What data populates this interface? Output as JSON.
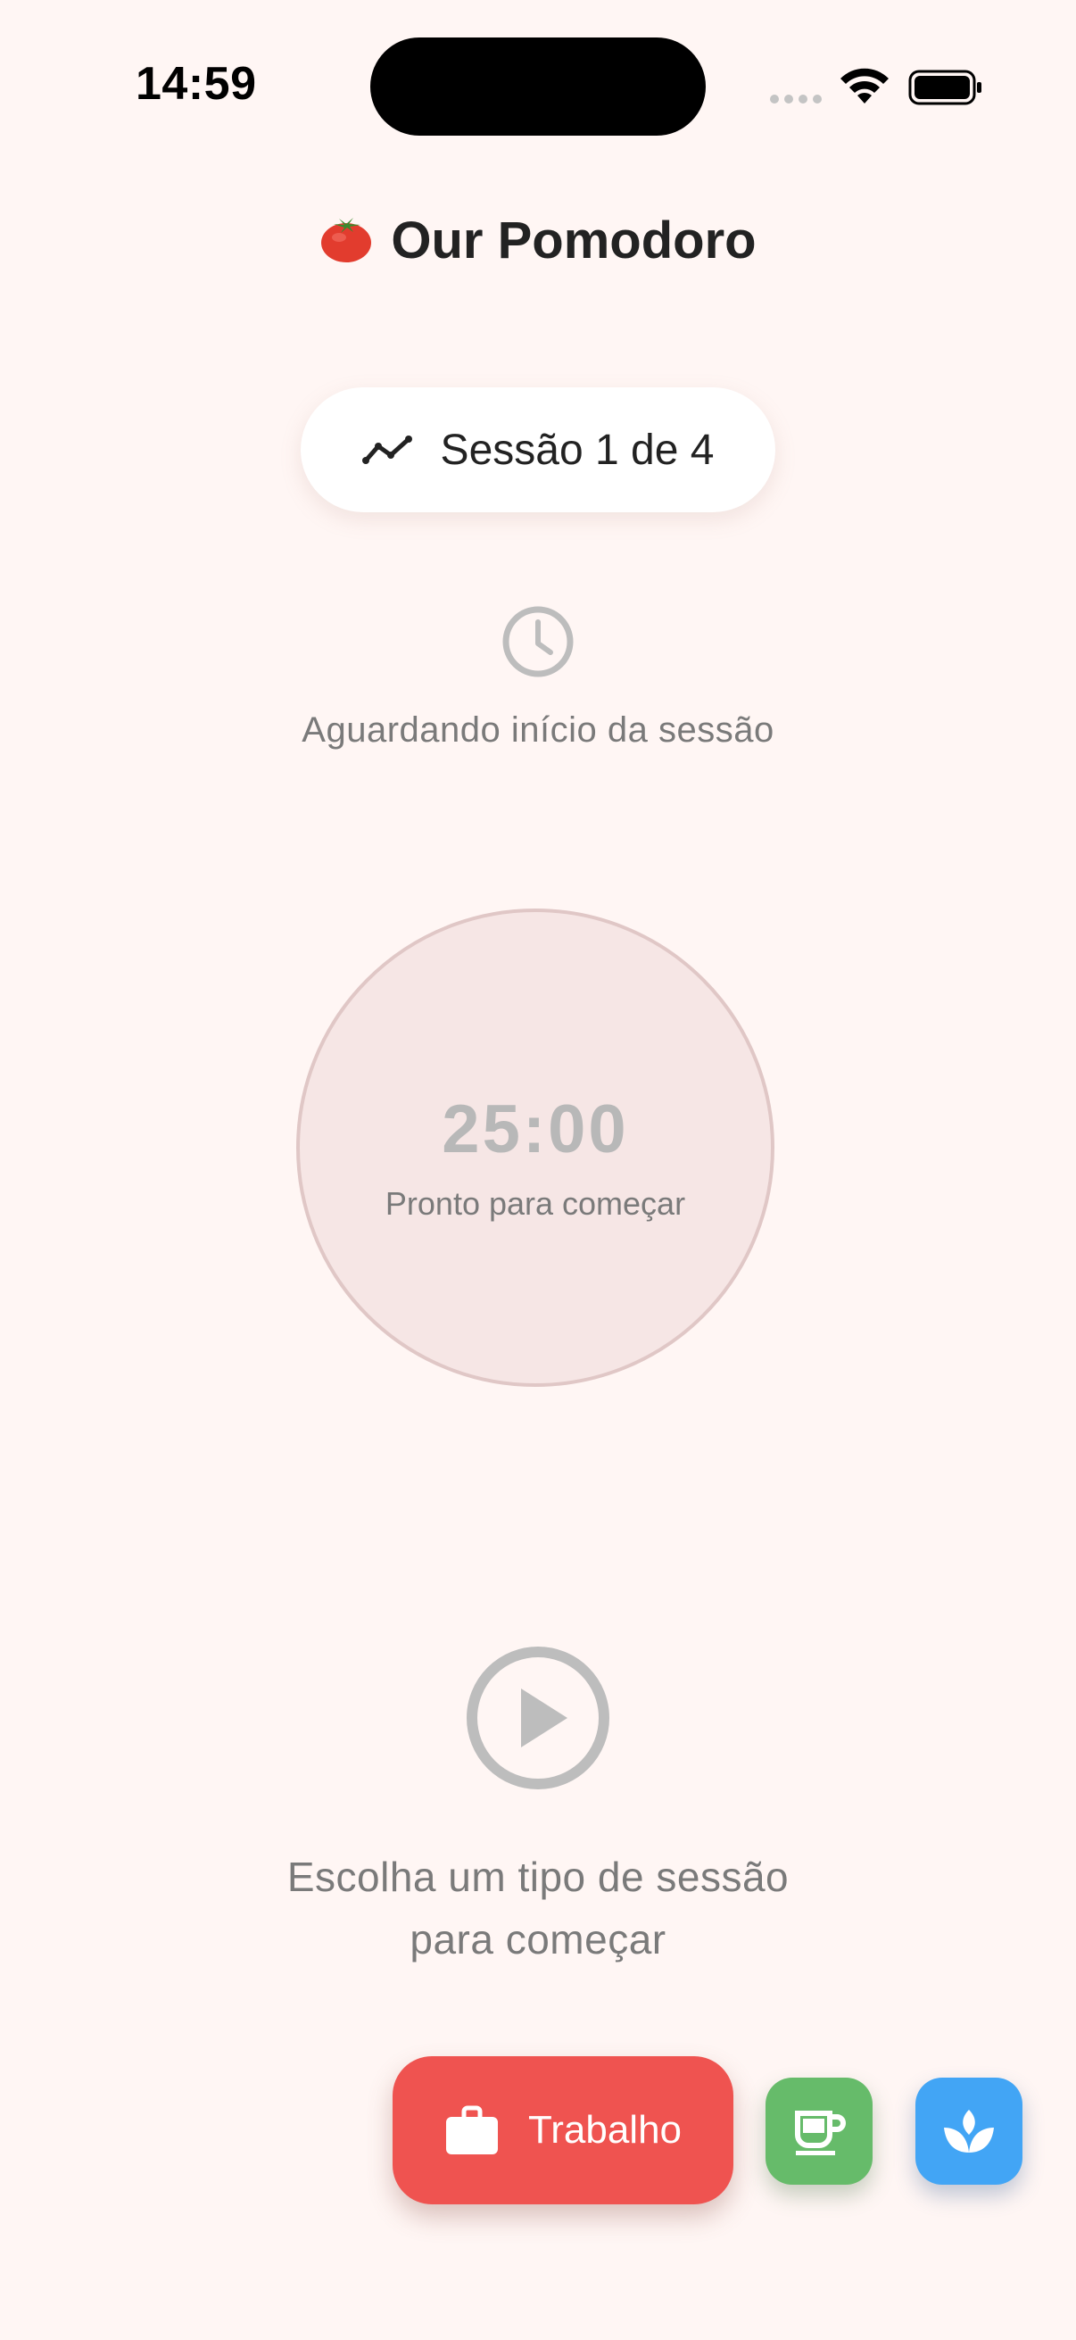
{
  "status_bar": {
    "time": "14:59"
  },
  "header": {
    "title": "Our Pomodoro",
    "icon": "tomato-icon"
  },
  "session": {
    "label": "Sessão 1 de 4",
    "icon": "trend-icon"
  },
  "status": {
    "icon": "clock-icon",
    "text": "Aguardando início da sessão"
  },
  "timer": {
    "value": "25:00",
    "subtitle": "Pronto para começar"
  },
  "controls": {
    "play_icon": "play-circle-icon",
    "hint_line1": "Escolha um tipo de sessão",
    "hint_line2": "para começar"
  },
  "session_types": [
    {
      "label": "Trabalho",
      "icon": "briefcase-icon",
      "color": "#ef5350"
    },
    {
      "label": "",
      "icon": "coffee-cup-icon",
      "color": "#66bb6a"
    },
    {
      "label": "",
      "icon": "spa-lotus-icon",
      "color": "#42a5f5"
    }
  ],
  "colors": {
    "background": "#fff6f4",
    "timer_fill": "#f6e6e5",
    "timer_border": "#e0c7c6"
  }
}
